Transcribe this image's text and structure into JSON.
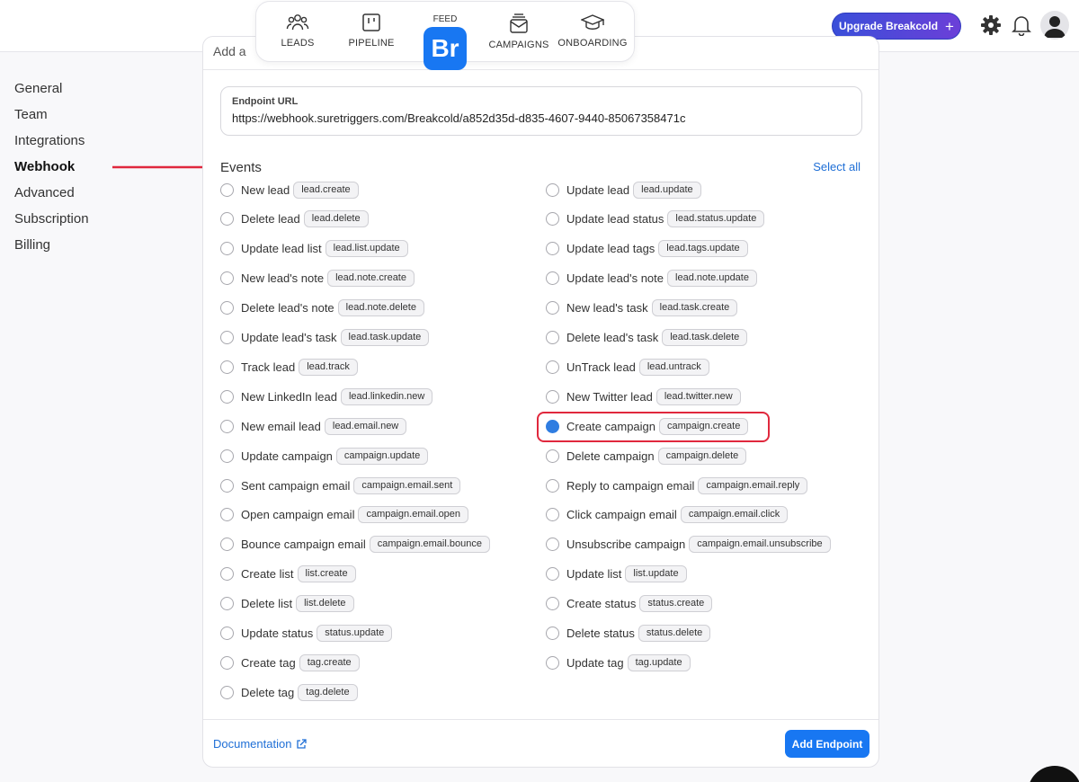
{
  "nav": {
    "leads": "LEADS",
    "pipeline": "PIPELINE",
    "feed": "FEED",
    "logo": "Br",
    "campaigns": "CAMPAIGNS",
    "onboarding": "ONBOARDING"
  },
  "header": {
    "upgrade_label": "Upgrade Breakcold",
    "upgrade_plus": "+"
  },
  "sidebar": {
    "items": [
      "General",
      "Team",
      "Integrations",
      "Webhook",
      "Advanced",
      "Subscription",
      "Billing"
    ],
    "active": "Webhook"
  },
  "card": {
    "header_partial": "Add a",
    "endpoint_label": "Endpoint URL",
    "endpoint_value": "https://webhook.suretriggers.com/Breakcold/a852d35d-d835-4607-9440-85067358471c",
    "events_title": "Events",
    "select_all": "Select all",
    "documentation": "Documentation",
    "add_endpoint": "Add Endpoint"
  },
  "events_left": [
    {
      "label": "New lead",
      "tag": "lead.create",
      "checked": false
    },
    {
      "label": "Delete lead",
      "tag": "lead.delete",
      "checked": false
    },
    {
      "label": "Update lead list",
      "tag": "lead.list.update",
      "checked": false
    },
    {
      "label": "New lead's note",
      "tag": "lead.note.create",
      "checked": false
    },
    {
      "label": "Delete lead's note",
      "tag": "lead.note.delete",
      "checked": false
    },
    {
      "label": "Update lead's task",
      "tag": "lead.task.update",
      "checked": false
    },
    {
      "label": "Track lead",
      "tag": "lead.track",
      "checked": false
    },
    {
      "label": "New LinkedIn lead",
      "tag": "lead.linkedin.new",
      "checked": false
    },
    {
      "label": "New email lead",
      "tag": "lead.email.new",
      "checked": false
    },
    {
      "label": "Update campaign",
      "tag": "campaign.update",
      "checked": false
    },
    {
      "label": "Sent campaign email",
      "tag": "campaign.email.sent",
      "checked": false
    },
    {
      "label": "Open campaign email",
      "tag": "campaign.email.open",
      "checked": false
    },
    {
      "label": "Bounce campaign email",
      "tag": "campaign.email.bounce",
      "checked": false
    },
    {
      "label": "Create list",
      "tag": "list.create",
      "checked": false
    },
    {
      "label": "Delete list",
      "tag": "list.delete",
      "checked": false
    },
    {
      "label": "Update status",
      "tag": "status.update",
      "checked": false
    },
    {
      "label": "Create tag",
      "tag": "tag.create",
      "checked": false
    },
    {
      "label": "Delete tag",
      "tag": "tag.delete",
      "checked": false
    }
  ],
  "events_right": [
    {
      "label": "Update lead",
      "tag": "lead.update",
      "checked": false
    },
    {
      "label": "Update lead status",
      "tag": "lead.status.update",
      "checked": false
    },
    {
      "label": "Update lead tags",
      "tag": "lead.tags.update",
      "checked": false
    },
    {
      "label": "Update lead's note",
      "tag": "lead.note.update",
      "checked": false
    },
    {
      "label": "New lead's task",
      "tag": "lead.task.create",
      "checked": false
    },
    {
      "label": "Delete lead's task",
      "tag": "lead.task.delete",
      "checked": false
    },
    {
      "label": "UnTrack lead",
      "tag": "lead.untrack",
      "checked": false
    },
    {
      "label": "New Twitter lead",
      "tag": "lead.twitter.new",
      "checked": false
    },
    {
      "label": "Create campaign",
      "tag": "campaign.create",
      "checked": true
    },
    {
      "label": "Delete campaign",
      "tag": "campaign.delete",
      "checked": false
    },
    {
      "label": "Reply to campaign email",
      "tag": "campaign.email.reply",
      "checked": false
    },
    {
      "label": "Click campaign email",
      "tag": "campaign.email.click",
      "checked": false
    },
    {
      "label": "Unsubscribe campaign",
      "tag": "campaign.email.unsubscribe",
      "checked": false
    },
    {
      "label": "Update list",
      "tag": "list.update",
      "checked": false
    },
    {
      "label": "Create status",
      "tag": "status.create",
      "checked": false
    },
    {
      "label": "Delete status",
      "tag": "status.delete",
      "checked": false
    },
    {
      "label": "Update tag",
      "tag": "tag.update",
      "checked": false
    }
  ],
  "colors": {
    "accent": "#1877f2",
    "checked": "#2f7de1",
    "highlight": "#e0283d",
    "link": "#1f6fd6"
  }
}
